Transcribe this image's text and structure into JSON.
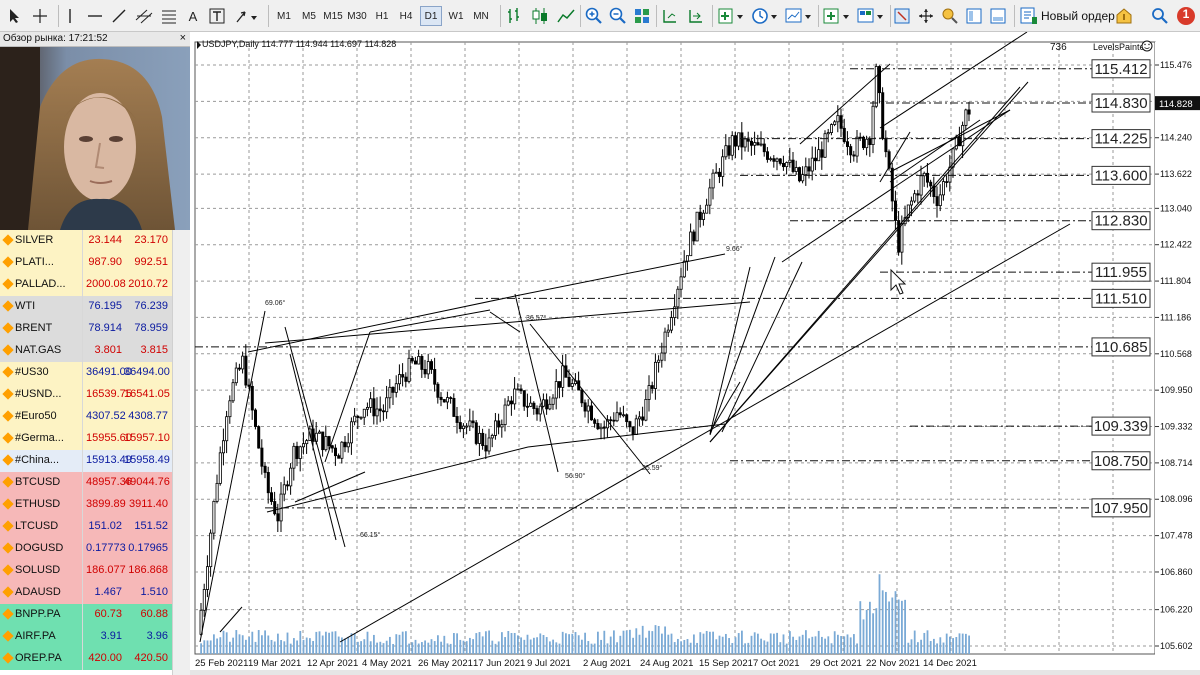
{
  "toolbar": {
    "timeframes": [
      "M1",
      "M5",
      "M15",
      "M30",
      "H1",
      "H4",
      "D1",
      "W1",
      "MN"
    ],
    "active_timeframe": "D1",
    "new_order_label": "Новый ордер",
    "alert_count": "1"
  },
  "market_watch": {
    "title": "Обзор рынка: 17:21:52",
    "close_glyph": "×",
    "rows": [
      {
        "symbol": "SILVER",
        "bid": "23.144",
        "ask": "23.170",
        "bg": "#fdf3c4",
        "price_color": "#d00000"
      },
      {
        "symbol": "PLATI...",
        "bid": "987.90",
        "ask": "992.51",
        "bg": "#fdf3c4",
        "price_color": "#d00000"
      },
      {
        "symbol": "PALLAD...",
        "bid": "2000.08",
        "ask": "2010.72",
        "bg": "#fdf3c4",
        "price_color": "#d00000"
      },
      {
        "symbol": "WTI",
        "bid": "76.195",
        "ask": "76.239",
        "bg": "#dcdcdc",
        "price_color": "#0a1aa0"
      },
      {
        "symbol": "BRENT",
        "bid": "78.914",
        "ask": "78.959",
        "bg": "#dcdcdc",
        "price_color": "#0a1aa0"
      },
      {
        "symbol": "NAT.GAS",
        "bid": "3.801",
        "ask": "3.815",
        "bg": "#dcdcdc",
        "price_color": "#d00000"
      },
      {
        "symbol": "#US30",
        "bid": "36491.00",
        "ask": "36494.00",
        "bg": "#fdf3c4",
        "price_color": "#0a1aa0"
      },
      {
        "symbol": "#USND...",
        "bid": "16539.75",
        "ask": "16541.05",
        "bg": "#fdf3c4",
        "price_color": "#d00000"
      },
      {
        "symbol": "#Euro50",
        "bid": "4307.52",
        "ask": "4308.77",
        "bg": "#fdf3c4",
        "price_color": "#0a1aa0"
      },
      {
        "symbol": "#Germa...",
        "bid": "15955.60",
        "ask": "15957.10",
        "bg": "#fdf3c4",
        "price_color": "#d00000"
      },
      {
        "symbol": "#China...",
        "bid": "15913.49",
        "ask": "15958.49",
        "bg": "#e4ecf7",
        "price_color": "#0a1aa0"
      },
      {
        "symbol": "BTCUSD",
        "bid": "48957.36",
        "ask": "49044.76",
        "bg": "#f6b8b8",
        "price_color": "#d00000"
      },
      {
        "symbol": "ETHUSD",
        "bid": "3899.89",
        "ask": "3911.40",
        "bg": "#f6b8b8",
        "price_color": "#d00000"
      },
      {
        "symbol": "LTCUSD",
        "bid": "151.02",
        "ask": "151.52",
        "bg": "#f6b8b8",
        "price_color": "#0a1aa0"
      },
      {
        "symbol": "DOGUSD",
        "bid": "0.17773",
        "ask": "0.17965",
        "bg": "#f6b8b8",
        "price_color": "#0a1aa0"
      },
      {
        "symbol": "SOLUSD",
        "bid": "186.077",
        "ask": "186.868",
        "bg": "#f6b8b8",
        "price_color": "#d00000"
      },
      {
        "symbol": "ADAUSD",
        "bid": "1.467",
        "ask": "1.510",
        "bg": "#f6b8b8",
        "price_color": "#0a1aa0"
      },
      {
        "symbol": "BNPP.PA",
        "bid": "60.73",
        "ask": "60.88",
        "bg": "#6fe0b0",
        "price_color": "#d00000"
      },
      {
        "symbol": "AIRF.PA",
        "bid": "3.91",
        "ask": "3.96",
        "bg": "#6fe0b0",
        "price_color": "#0a1aa0"
      },
      {
        "symbol": "OREP.PA",
        "bid": "420.00",
        "ask": "420.50",
        "bg": "#6fe0b0",
        "price_color": "#d00000"
      }
    ]
  },
  "chart": {
    "header": "USDJPY,Daily  114.777 114.944 114.697 114.828",
    "top_right_number": "736",
    "indicator_name": "LevelsPainter",
    "current_price": "114.828",
    "axis_ticks": [
      "115.476",
      "114.858",
      "114.240",
      "113.622",
      "113.040",
      "112.422",
      "111.804",
      "111.186",
      "110.568",
      "109.950",
      "109.332",
      "108.714",
      "108.096",
      "107.478",
      "106.860",
      "106.220",
      "105.602"
    ],
    "date_ticks": [
      "25 Feb 2021",
      "19 Mar 2021",
      "12 Apr 2021",
      "4 May 2021",
      "26 May 2021",
      "17 Jun 2021",
      "9 Jul 2021",
      "2 Aug 2021",
      "24 Aug 2021",
      "15 Sep 2021",
      "7 Oct 2021",
      "29 Oct 2021",
      "22 Nov 2021",
      "14 Dec 2021"
    ],
    "levels": [
      "115.412",
      "114.830",
      "114.225",
      "113.600",
      "112.830",
      "111.955",
      "111.510",
      "110.685",
      "109.339",
      "108.750",
      "107.950"
    ],
    "angle_labels": [
      "69.06°",
      "36.57°",
      "56.90°",
      "25.59°",
      "66.15°",
      "9.66°"
    ]
  }
}
